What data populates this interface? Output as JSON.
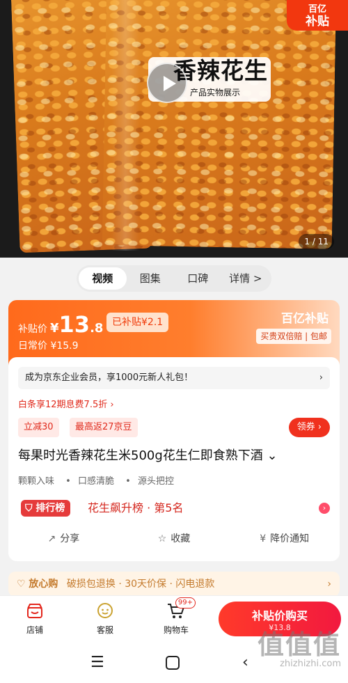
{
  "hero": {
    "badge_logo": "百亿",
    "badge_text": "补贴",
    "video_title": "香辣花生",
    "video_subtitle": "产品实物展示",
    "counter": "1 / 11"
  },
  "tabs": [
    {
      "label": "视频"
    },
    {
      "label": "图集"
    },
    {
      "label": "口碑"
    },
    {
      "label": "详情 >"
    }
  ],
  "price_card": {
    "label": "补贴价",
    "currency": "¥",
    "price_int": "13",
    "price_dec": ".8",
    "subsidy_tag": "已补贴¥2.1",
    "regular_label": "日常价",
    "regular_price": "¥15.9",
    "brand": "百亿补贴",
    "guarantee": "买贵双倍赔 | 包邮"
  },
  "info": {
    "member_text": "成为京东企业会员，享1000元新人礼包！",
    "member_chevron": "›",
    "installment": "白条享12期息费7.5折 ›",
    "promo1": "立减30",
    "promo2": "最高返27京豆",
    "coupon_btn": "领券 ›",
    "title": "每果时光香辣花生米500g花生仁即食熟下酒 ⌄",
    "features": [
      "颗颗入味",
      "口感清脆",
      "源头把控"
    ],
    "rank_badge": "排行榜",
    "rank_text": "花生飙升榜 · 第5名",
    "actions": [
      {
        "icon": "share-icon",
        "glyph": "↗",
        "label": "分享"
      },
      {
        "icon": "star-icon",
        "glyph": "☆",
        "label": "收藏"
      },
      {
        "icon": "price-drop-icon",
        "glyph": "¥",
        "label": "降价通知"
      }
    ]
  },
  "assurance": {
    "brand": "♡ 放心购",
    "text": "破损包退换 · 30天价保 · 闪电退款",
    "chevron": "›"
  },
  "bottom_bar": {
    "store": "店铺",
    "service": "客服",
    "cart": "购物车",
    "cart_count": "99+",
    "buy_line1": "补贴价购买",
    "buy_line2": "¥13.8"
  },
  "watermark": {
    "big": "值值值",
    "small": "zhizhizhi.com"
  },
  "colors": {
    "accent_red": "#f0311e",
    "subsidy_orange": "#ff6a1c"
  }
}
